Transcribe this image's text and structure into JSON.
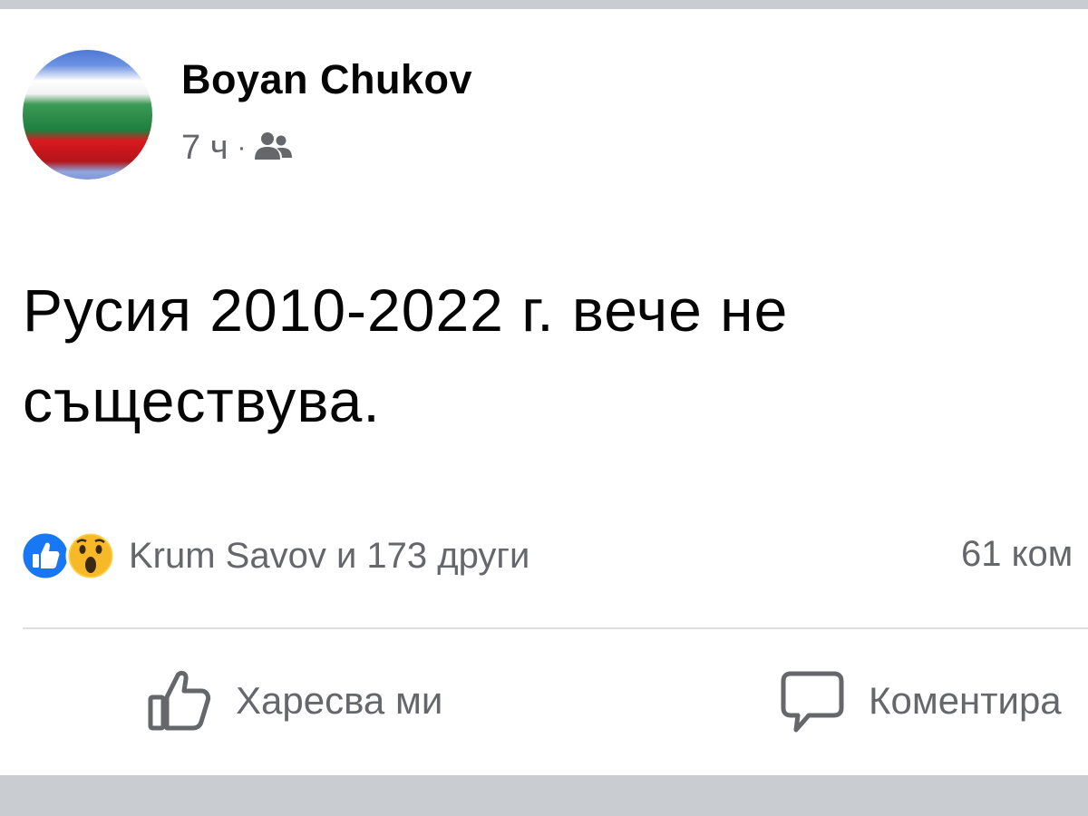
{
  "post": {
    "author": "Boyan Chukov",
    "time": "7 ч",
    "separator": "·",
    "audience_icon": "friends-icon",
    "text_line1": "Русия 2010-2022 г. вече не",
    "text_line2": "съществува.",
    "avatar": "bulgarian-flag-avatar"
  },
  "reactions": {
    "icons": [
      "like-reaction-icon",
      "wow-reaction-icon"
    ],
    "names": "Krum Savov и 173 други",
    "comments": "61 ком"
  },
  "actions": {
    "like_label": "Харесва ми",
    "comment_label": "Коментира"
  },
  "colors": {
    "like_blue": "#1877f2",
    "wow_yellow": "#fcd34d",
    "secondary_text": "#65676b",
    "separator_gray": "#c9ccd1"
  }
}
